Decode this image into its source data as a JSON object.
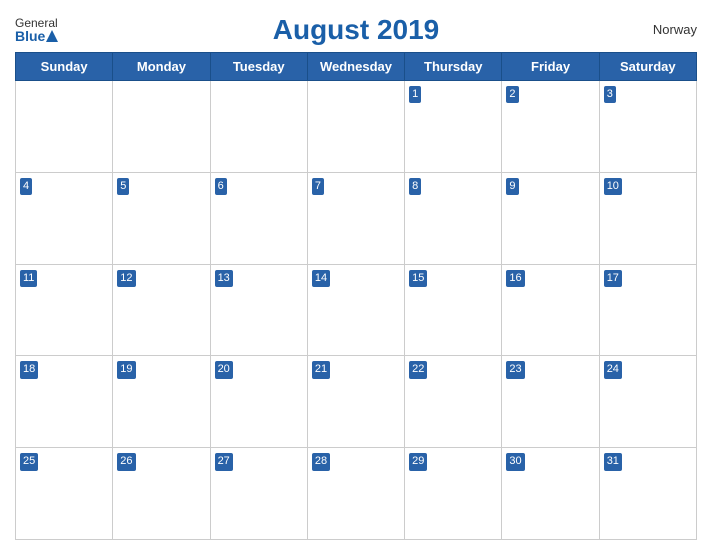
{
  "header": {
    "logo_general": "General",
    "logo_blue": "Blue",
    "title": "August 2019",
    "country": "Norway"
  },
  "weekdays": [
    "Sunday",
    "Monday",
    "Tuesday",
    "Wednesday",
    "Thursday",
    "Friday",
    "Saturday"
  ],
  "weeks": [
    [
      null,
      null,
      null,
      null,
      1,
      2,
      3
    ],
    [
      4,
      5,
      6,
      7,
      8,
      9,
      10
    ],
    [
      11,
      12,
      13,
      14,
      15,
      16,
      17
    ],
    [
      18,
      19,
      20,
      21,
      22,
      23,
      24
    ],
    [
      25,
      26,
      27,
      28,
      29,
      30,
      31
    ]
  ]
}
